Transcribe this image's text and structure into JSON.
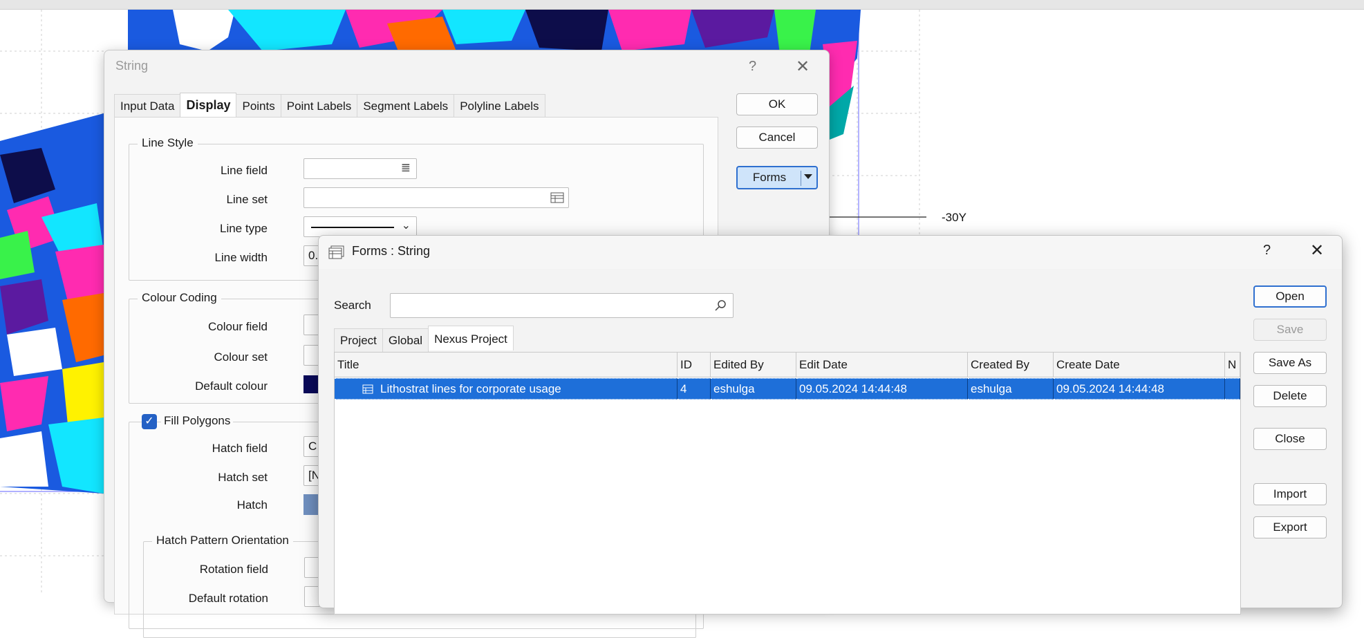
{
  "map": {
    "axis_label": "-30Y"
  },
  "string_dialog": {
    "title": "String",
    "help_glyph": "?",
    "close_glyph": "✕",
    "tabs": [
      "Input Data",
      "Display",
      "Points",
      "Point Labels",
      "Segment Labels",
      "Polyline Labels"
    ],
    "active_tab": "Display",
    "buttons": {
      "ok": "OK",
      "cancel": "Cancel",
      "forms": "Forms"
    },
    "line_style": {
      "group_label": "Line Style",
      "line_field_label": "Line field",
      "line_set_label": "Line set",
      "line_type_label": "Line type",
      "line_width_label": "Line width",
      "line_width_value": "0."
    },
    "colour_coding": {
      "group_label": "Colour Coding",
      "colour_field_label": "Colour field",
      "colour_set_label": "Colour set",
      "default_colour_label": "Default colour",
      "default_colour": "#0a0a5a"
    },
    "fill_polygons": {
      "label": "Fill Polygons",
      "checked": true,
      "hatch_field_label": "Hatch field",
      "hatch_field_value": "C",
      "hatch_set_label": "Hatch set",
      "hatch_set_value": "[N",
      "hatch_label": "Hatch",
      "hatch_colour": "#7090c0"
    },
    "hatch_orientation": {
      "group_label": "Hatch Pattern Orientation",
      "rotation_field_label": "Rotation field",
      "default_rotation_label": "Default rotation"
    }
  },
  "forms_dialog": {
    "title": "Forms : String",
    "help_glyph": "?",
    "close_glyph": "✕",
    "search_label": "Search",
    "search_value": "",
    "tabs": [
      "Project",
      "Global",
      "Nexus Project"
    ],
    "active_tab": "Nexus Project",
    "columns": [
      "Title",
      "ID",
      "Edited By",
      "Edit Date",
      "Created By",
      "Create Date",
      "N"
    ],
    "rows": [
      {
        "title": "Lithostrat lines for corporate usage",
        "id": "4",
        "edited_by": "eshulga",
        "edit_date": "09.05.2024 14:44:48",
        "created_by": "eshulga",
        "create_date": "09.05.2024 14:44:48",
        "selected": true
      }
    ],
    "buttons": {
      "open": "Open",
      "save": "Save",
      "save_as": "Save As",
      "delete": "Delete",
      "close": "Close",
      "import": "Import",
      "export": "Export"
    }
  }
}
